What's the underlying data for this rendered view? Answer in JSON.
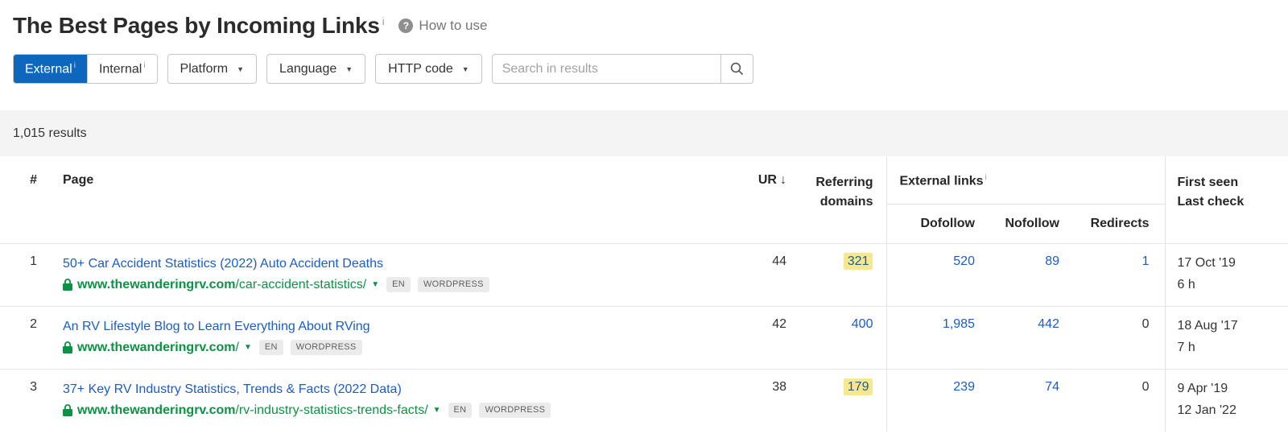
{
  "ui": {
    "info": "i",
    "caret_down": "▼",
    "sort_desc": "↓",
    "help_icon_char": "?"
  },
  "colors": {
    "accent_blue": "#0d68bd",
    "link_blue": "#1a5dc8",
    "url_green": "#0d9144",
    "highlight_yellow": "#f6e88e",
    "results_bar_gray": "#f4f4f4"
  },
  "header": {
    "title": "The Best Pages by Incoming Links",
    "help_label": "How to use"
  },
  "filters": {
    "segmented": [
      {
        "label": "External"
      },
      {
        "label": "Internal"
      }
    ],
    "dropdowns": [
      {
        "label": "Platform"
      },
      {
        "label": "Language"
      },
      {
        "label": "HTTP code"
      }
    ],
    "search": {
      "placeholder": "Search in results"
    }
  },
  "results_bar": {
    "text": "1,015 results"
  },
  "table": {
    "columns": {
      "index": "#",
      "page": "Page",
      "ur": "UR",
      "referring_line1": "Referring",
      "referring_line2": "domains",
      "external_links": "External links",
      "dofollow": "Dofollow",
      "nofollow": "Nofollow",
      "redirects": "Redirects",
      "first_seen_line1": "First seen",
      "first_seen_line2": "Last check"
    },
    "rows": [
      {
        "index": "1",
        "title": "50+ Car Accident Statistics (2022) Auto Accident Deaths",
        "domain": "www.thewanderingrv.com",
        "path": "/car-accident-statistics/",
        "lang": "EN",
        "platform": "WORDPRESS",
        "ur": "44",
        "referring_domains": "321",
        "rd_highlight": true,
        "dofollow": "520",
        "nofollow": "89",
        "redirects": "1",
        "redirects_is_link": true,
        "first_seen": "17 Oct '19",
        "last_check": "6 h"
      },
      {
        "index": "2",
        "title": "An RV Lifestyle Blog to Learn Everything About RVing",
        "domain": "www.thewanderingrv.com",
        "path": "/",
        "lang": "EN",
        "platform": "WORDPRESS",
        "ur": "42",
        "referring_domains": "400",
        "rd_highlight": false,
        "dofollow": "1,985",
        "nofollow": "442",
        "redirects": "0",
        "redirects_is_link": false,
        "first_seen": "18 Aug '17",
        "last_check": "7 h"
      },
      {
        "index": "3",
        "title": "37+ Key RV Industry Statistics, Trends & Facts (2022 Data)",
        "domain": "www.thewanderingrv.com",
        "path": "/rv-industry-statistics-trends-facts/",
        "lang": "EN",
        "platform": "WORDPRESS",
        "ur": "38",
        "referring_domains": "179",
        "rd_highlight": true,
        "dofollow": "239",
        "nofollow": "74",
        "redirects": "0",
        "redirects_is_link": false,
        "first_seen": "9 Apr '19",
        "last_check": "12 Jan '22"
      }
    ]
  }
}
